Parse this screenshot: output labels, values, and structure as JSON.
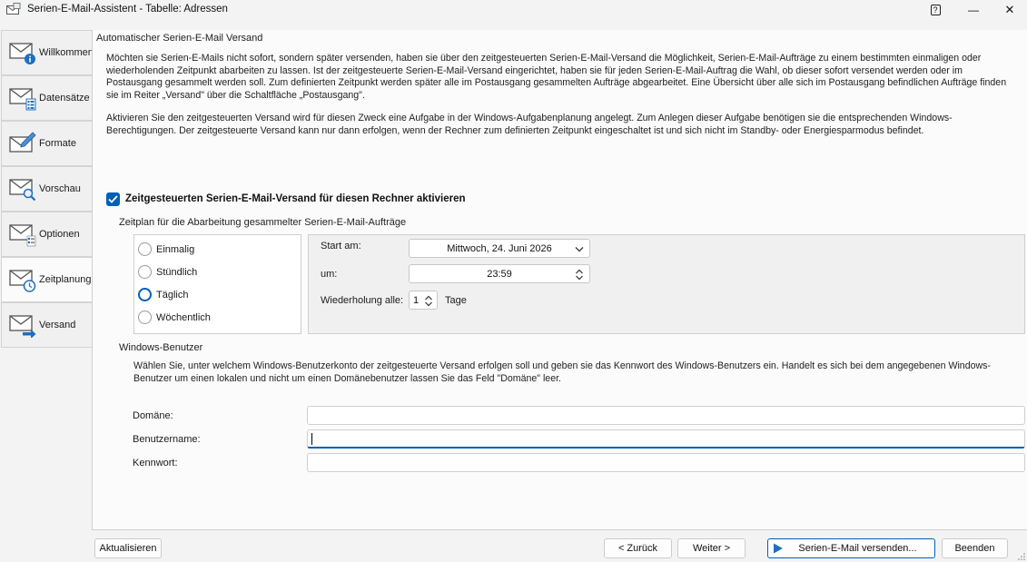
{
  "window": {
    "title": "Serien-E-Mail-Assistent - Tabelle: Adressen",
    "help_glyph": "?",
    "minimize_glyph": "—",
    "close_glyph": "✕"
  },
  "nav": {
    "items": [
      {
        "label": "Willkommen",
        "icon": "envelope-info-icon"
      },
      {
        "label": "Datensätze",
        "icon": "envelope-records-icon"
      },
      {
        "label": "Formate",
        "icon": "envelope-pen-icon"
      },
      {
        "label": "Vorschau",
        "icon": "envelope-magnifier-icon"
      },
      {
        "label": "Optionen",
        "icon": "envelope-options-icon"
      },
      {
        "label": "Zeitplanung",
        "icon": "envelope-clock-icon"
      },
      {
        "label": "Versand",
        "icon": "envelope-send-icon"
      }
    ],
    "active_index": 5
  },
  "main": {
    "section_title": "Automatischer Serien-E-Mail Versand",
    "paragraph1": "Möchten sie Serien-E-Mails nicht sofort, sondern später versenden, haben sie über den zeitgesteuerten Serien-E-Mail-Versand die Möglichkeit, Serien-E-Mail-Aufträge zu einem bestimmten einmaligen oder wiederholenden Zeitpunkt abarbeiten zu lassen. Ist der zeitgesteuerte Serien-E-Mail-Versand eingerichtet, haben sie für jeden Serien-E-Mail-Auftrag die Wahl, ob dieser sofort versendet werden oder im Postausgang gesammelt werden soll. Zum definierten Zeitpunkt werden später alle im Postausgang gesammelten Aufträge abgearbeitet. Eine Übersicht über alle sich im Postausgang befindlichen Aufträge finden sie im Reiter „Versand\" über die Schaltfläche „Postausgang\".",
    "paragraph2": "Aktivieren Sie den zeitgesteuerten Versand wird für diesen Zweck eine Aufgabe in der Windows-Aufgabenplanung angelegt. Zum Anlegen dieser Aufgabe benötigen sie die entsprechenden Windows-Berechtigungen. Der zeitgesteuerte Versand kann nur dann erfolgen, wenn der Rechner zum definierten Zeitpunkt eingeschaltet ist und sich nicht im Standby- oder Energiesparmodus befindet.",
    "enable_label": "Zeitgesteuerten Serien-E-Mail-Versand für diesen Rechner aktivieren",
    "enable_checked": true
  },
  "schedule": {
    "title": "Zeitplan für die Abarbeitung gesammelter Serien-E-Mail-Aufträge",
    "options": [
      "Einmalig",
      "Stündlich",
      "Täglich",
      "Wöchentlich"
    ],
    "selected": "Täglich",
    "start_label": "Start am:",
    "start_value": "Mittwoch, 24. Juni 2026",
    "time_label": "um:",
    "time_value": "23:59",
    "repeat_label": "Wiederholung alle:",
    "repeat_value": "1",
    "repeat_unit": "Tage"
  },
  "user": {
    "title": "Windows-Benutzer",
    "description": "Wählen Sie, unter welchem Windows-Benutzerkonto der zeitgesteuerte Versand erfolgen soll und geben sie das Kennwort des Windows-Benutzers ein. Handelt es sich bei dem angegebenen Windows-Benutzer um einen lokalen und nicht um einen Domänebenutzer lassen Sie das Feld \"Domäne\" leer.",
    "domain_label": "Domäne:",
    "domain_value": "",
    "username_label": "Benutzername:",
    "username_value": "",
    "password_label": "Kennwort:",
    "password_value": ""
  },
  "footer": {
    "refresh": "Aktualisieren",
    "back": "< Zurück",
    "next": "Weiter >",
    "send": "Serien-E-Mail versenden...",
    "close": "Beenden"
  },
  "colors": {
    "accent": "#005fb8"
  }
}
